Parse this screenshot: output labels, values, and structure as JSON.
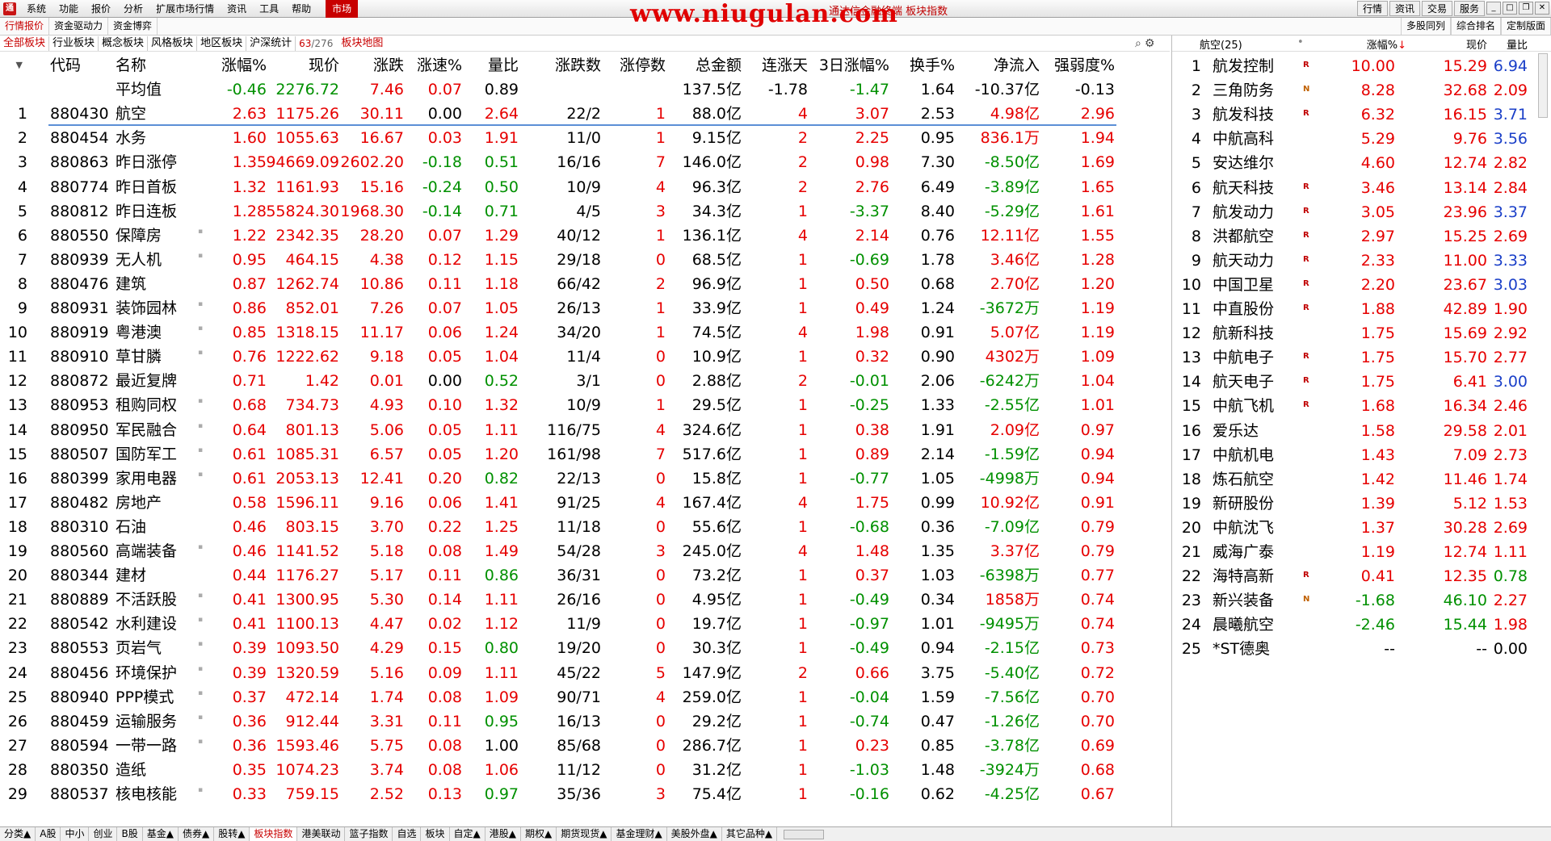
{
  "menubar": {
    "items": [
      "系统",
      "功能",
      "报价",
      "分析",
      "扩展市场行情",
      "资讯",
      "工具",
      "帮助"
    ],
    "active": "市场",
    "watermark": "www.niugulan.com",
    "subtitle": "通达信金融终端 板块指数",
    "right_buttons": [
      "行情",
      "资讯",
      "交易",
      "服务"
    ],
    "window_controls": [
      "_",
      "□",
      "❐",
      "✕"
    ]
  },
  "tabs_left": [
    "行情报价",
    "资金驱动力",
    "资金博弈"
  ],
  "tabs_right": [
    "多股同列",
    "综合排名",
    "定制版面"
  ],
  "categories": [
    "全部板块",
    "行业板块",
    "概念板块",
    "风格板块",
    "地区板块",
    "沪深统计"
  ],
  "counter": {
    "current": "63",
    "total": "276"
  },
  "map_label": "板块地图",
  "main_headers": {
    "code": "代码",
    "name": "名称",
    "chg_pct": "涨幅%",
    "chg_arrow": "↓",
    "price": "现价",
    "chg": "涨跌",
    "speed": "涨速%",
    "vol_ratio": "量比",
    "updown": "涨跌数",
    "limit_up": "涨停数",
    "amount": "总金额",
    "streak": "连涨天",
    "chg3d": "3日涨幅%",
    "turnover": "换手%",
    "netflow": "净流入",
    "strength": "强弱度%"
  },
  "average": {
    "name": "平均值",
    "chg_pct": "-0.46",
    "price": "2276.72",
    "chg": "7.46",
    "speed": "0.07",
    "vol_ratio": "0.89",
    "amount": "137.5亿",
    "streak": "-1.78",
    "chg3d": "-1.47",
    "turnover": "1.64",
    "netflow": "-10.37亿",
    "strength": "-0.13"
  },
  "rows": [
    [
      "1",
      "880430",
      "航空",
      "2.63",
      "1175.26",
      "30.11",
      "0.00",
      "2.64",
      "22/2",
      "1",
      "88.0亿",
      "4",
      "3.07",
      "2.53",
      "4.98亿",
      "2.96"
    ],
    [
      "2",
      "880454",
      "水务",
      "1.60",
      "1055.63",
      "16.67",
      "0.03",
      "1.91",
      "11/0",
      "1",
      "9.15亿",
      "2",
      "2.25",
      "0.95",
      "836.1万",
      "1.94"
    ],
    [
      "3",
      "880863",
      "昨日涨停",
      "1.35",
      "94669.09",
      "2602.20",
      "-0.18",
      "0.51",
      "16/16",
      "7",
      "146.0亿",
      "2",
      "0.98",
      "7.30",
      "-8.50亿",
      "1.69"
    ],
    [
      "4",
      "880774",
      "昨日首板",
      "1.32",
      "1161.93",
      "15.16",
      "-0.24",
      "0.50",
      "10/9",
      "4",
      "96.3亿",
      "2",
      "2.76",
      "6.49",
      "-3.89亿",
      "1.65"
    ],
    [
      "5",
      "880812",
      "昨日连板",
      "1.28",
      "55824.30",
      "1968.30",
      "-0.14",
      "0.71",
      "4/5",
      "3",
      "34.3亿",
      "1",
      "-3.37",
      "8.40",
      "-5.29亿",
      "1.61"
    ],
    [
      "6",
      "880550",
      "保障房",
      "1.22",
      "2342.35",
      "28.20",
      "0.07",
      "1.29",
      "40/12",
      "1",
      "136.1亿",
      "4",
      "2.14",
      "0.76",
      "12.11亿",
      "1.55"
    ],
    [
      "7",
      "880939",
      "无人机",
      "0.95",
      "464.15",
      "4.38",
      "0.12",
      "1.15",
      "29/18",
      "0",
      "68.5亿",
      "1",
      "-0.69",
      "1.78",
      "3.46亿",
      "1.28"
    ],
    [
      "8",
      "880476",
      "建筑",
      "0.87",
      "1262.74",
      "10.86",
      "0.11",
      "1.18",
      "66/42",
      "2",
      "96.9亿",
      "1",
      "0.50",
      "0.68",
      "2.70亿",
      "1.20"
    ],
    [
      "9",
      "880931",
      "装饰园林",
      "0.86",
      "852.01",
      "7.26",
      "0.07",
      "1.05",
      "26/13",
      "1",
      "33.9亿",
      "1",
      "0.49",
      "1.24",
      "-3672万",
      "1.19"
    ],
    [
      "10",
      "880919",
      "粤港澳",
      "0.85",
      "1318.15",
      "11.17",
      "0.06",
      "1.24",
      "34/20",
      "1",
      "74.5亿",
      "4",
      "1.98",
      "0.91",
      "5.07亿",
      "1.19"
    ],
    [
      "11",
      "880910",
      "草甘膦",
      "0.76",
      "1222.62",
      "9.18",
      "0.05",
      "1.04",
      "11/4",
      "0",
      "10.9亿",
      "1",
      "0.32",
      "0.90",
      "4302万",
      "1.09"
    ],
    [
      "12",
      "880872",
      "最近复牌",
      "0.71",
      "1.42",
      "0.01",
      "0.00",
      "0.52",
      "3/1",
      "0",
      "2.88亿",
      "2",
      "-0.01",
      "2.06",
      "-6242万",
      "1.04"
    ],
    [
      "13",
      "880953",
      "租购同权",
      "0.68",
      "734.73",
      "4.93",
      "0.10",
      "1.32",
      "10/9",
      "1",
      "29.5亿",
      "1",
      "-0.25",
      "1.33",
      "-2.55亿",
      "1.01"
    ],
    [
      "14",
      "880950",
      "军民融合",
      "0.64",
      "801.13",
      "5.06",
      "0.05",
      "1.11",
      "116/75",
      "4",
      "324.6亿",
      "1",
      "0.38",
      "1.91",
      "2.09亿",
      "0.97"
    ],
    [
      "15",
      "880507",
      "国防军工",
      "0.61",
      "1085.31",
      "6.57",
      "0.05",
      "1.20",
      "161/98",
      "7",
      "517.6亿",
      "1",
      "0.89",
      "2.14",
      "-1.59亿",
      "0.94"
    ],
    [
      "16",
      "880399",
      "家用电器",
      "0.61",
      "2053.13",
      "12.41",
      "0.20",
      "0.82",
      "22/13",
      "0",
      "15.8亿",
      "1",
      "-0.77",
      "1.05",
      "-4998万",
      "0.94"
    ],
    [
      "17",
      "880482",
      "房地产",
      "0.58",
      "1596.11",
      "9.16",
      "0.06",
      "1.41",
      "91/25",
      "4",
      "167.4亿",
      "4",
      "1.75",
      "0.99",
      "10.92亿",
      "0.91"
    ],
    [
      "18",
      "880310",
      "石油",
      "0.46",
      "803.15",
      "3.70",
      "0.22",
      "1.25",
      "11/18",
      "0",
      "55.6亿",
      "1",
      "-0.68",
      "0.36",
      "-7.09亿",
      "0.79"
    ],
    [
      "19",
      "880560",
      "高端装备",
      "0.46",
      "1141.52",
      "5.18",
      "0.08",
      "1.49",
      "54/28",
      "3",
      "245.0亿",
      "4",
      "1.48",
      "1.35",
      "3.37亿",
      "0.79"
    ],
    [
      "20",
      "880344",
      "建材",
      "0.44",
      "1176.27",
      "5.17",
      "0.11",
      "0.86",
      "36/31",
      "0",
      "73.2亿",
      "1",
      "0.37",
      "1.03",
      "-6398万",
      "0.77"
    ],
    [
      "21",
      "880889",
      "不活跃股",
      "0.41",
      "1300.95",
      "5.30",
      "0.14",
      "1.11",
      "26/16",
      "0",
      "4.95亿",
      "1",
      "-0.49",
      "0.34",
      "1858万",
      "0.74"
    ],
    [
      "22",
      "880542",
      "水利建设",
      "0.41",
      "1100.13",
      "4.47",
      "0.02",
      "1.12",
      "11/9",
      "0",
      "19.7亿",
      "1",
      "-0.97",
      "1.01",
      "-9495万",
      "0.74"
    ],
    [
      "23",
      "880553",
      "页岩气",
      "0.39",
      "1093.50",
      "4.29",
      "0.15",
      "0.80",
      "19/20",
      "0",
      "30.3亿",
      "1",
      "-0.49",
      "0.94",
      "-2.15亿",
      "0.73"
    ],
    [
      "24",
      "880456",
      "环境保护",
      "0.39",
      "1320.59",
      "5.16",
      "0.09",
      "1.11",
      "45/22",
      "5",
      "147.9亿",
      "2",
      "0.66",
      "3.75",
      "-5.40亿",
      "0.72"
    ],
    [
      "25",
      "880940",
      "PPP模式",
      "0.37",
      "472.14",
      "1.74",
      "0.08",
      "1.09",
      "90/71",
      "4",
      "259.0亿",
      "1",
      "-0.04",
      "1.59",
      "-7.56亿",
      "0.70"
    ],
    [
      "26",
      "880459",
      "运输服务",
      "0.36",
      "912.44",
      "3.31",
      "0.11",
      "0.95",
      "16/13",
      "0",
      "29.2亿",
      "1",
      "-0.74",
      "0.47",
      "-1.26亿",
      "0.70"
    ],
    [
      "27",
      "880594",
      "一带一路",
      "0.36",
      "1593.46",
      "5.75",
      "0.08",
      "1.00",
      "85/68",
      "0",
      "286.7亿",
      "1",
      "0.23",
      "0.85",
      "-3.78亿",
      "0.69"
    ],
    [
      "28",
      "880350",
      "造纸",
      "0.35",
      "1074.23",
      "3.74",
      "0.08",
      "1.06",
      "11/12",
      "0",
      "31.2亿",
      "1",
      "-1.03",
      "1.48",
      "-3924万",
      "0.68"
    ],
    [
      "29",
      "880537",
      "核电核能",
      "0.33",
      "759.15",
      "2.52",
      "0.13",
      "0.97",
      "35/36",
      "3",
      "75.4亿",
      "1",
      "-0.16",
      "0.62",
      "-4.25亿",
      "0.67"
    ]
  ],
  "dotted_rows": [
    6,
    7,
    9,
    10,
    11,
    13,
    14,
    15,
    16,
    19,
    21,
    22,
    23,
    24,
    25,
    26,
    27,
    29
  ],
  "right_panel": {
    "title": "航空(25)",
    "col_chg": "涨幅%",
    "col_arrow": "↓",
    "col_price": "现价",
    "col_ratio": "量比",
    "rows": [
      [
        "1",
        "航发控制",
        "R",
        "10.00",
        "15.29",
        "6.94"
      ],
      [
        "2",
        "三角防务",
        "N",
        "8.28",
        "32.68",
        "2.09"
      ],
      [
        "3",
        "航发科技",
        "R",
        "6.32",
        "16.15",
        "3.71"
      ],
      [
        "4",
        "中航高科",
        "",
        "5.29",
        "9.76",
        "3.56"
      ],
      [
        "5",
        "安达维尔",
        "",
        "4.60",
        "12.74",
        "2.82"
      ],
      [
        "6",
        "航天科技",
        "R",
        "3.46",
        "13.14",
        "2.84"
      ],
      [
        "7",
        "航发动力",
        "R",
        "3.05",
        "23.96",
        "3.37"
      ],
      [
        "8",
        "洪都航空",
        "R",
        "2.97",
        "15.25",
        "2.69"
      ],
      [
        "9",
        "航天动力",
        "R",
        "2.33",
        "11.00",
        "3.33"
      ],
      [
        "10",
        "中国卫星",
        "R",
        "2.20",
        "23.67",
        "3.03"
      ],
      [
        "11",
        "中直股份",
        "R",
        "1.88",
        "42.89",
        "1.90"
      ],
      [
        "12",
        "航新科技",
        "",
        "1.75",
        "15.69",
        "2.92"
      ],
      [
        "13",
        "中航电子",
        "R",
        "1.75",
        "15.70",
        "2.77"
      ],
      [
        "14",
        "航天电子",
        "R",
        "1.75",
        "6.41",
        "3.00"
      ],
      [
        "15",
        "中航飞机",
        "R",
        "1.68",
        "16.34",
        "2.46"
      ],
      [
        "16",
        "爱乐达",
        "",
        "1.58",
        "29.58",
        "2.01"
      ],
      [
        "17",
        "中航机电",
        "",
        "1.43",
        "7.09",
        "2.73"
      ],
      [
        "18",
        "炼石航空",
        "",
        "1.42",
        "11.46",
        "1.74"
      ],
      [
        "19",
        "新研股份",
        "",
        "1.39",
        "5.12",
        "1.53"
      ],
      [
        "20",
        "中航沈飞",
        "",
        "1.37",
        "30.28",
        "2.69"
      ],
      [
        "21",
        "威海广泰",
        "",
        "1.19",
        "12.74",
        "1.11"
      ],
      [
        "22",
        "海特高新",
        "R",
        "0.41",
        "12.35",
        "0.78"
      ],
      [
        "23",
        "新兴装备",
        "N",
        "-1.68",
        "46.10",
        "2.27"
      ],
      [
        "24",
        "晨曦航空",
        "",
        "-2.46",
        "15.44",
        "1.98"
      ],
      [
        "25",
        "*ST德奥",
        "",
        "--",
        "--",
        "0.00"
      ]
    ]
  },
  "bottom_tabs": [
    "分类▲",
    "A股",
    "中小",
    "创业",
    "B股",
    "基金▲",
    "债券▲",
    "股转▲",
    "板块指数",
    "港美联动",
    "篮子指数",
    "自选",
    "板块",
    "自定▲",
    "港股▲",
    "期权▲",
    "期货现货▲",
    "基金理财▲",
    "美股外盘▲",
    "其它品种▲"
  ],
  "active_bottom_tab": "板块指数",
  "colors": {
    "up": "#e60000",
    "down": "#009000",
    "accent": "#c80000",
    "ratio_high": "#1a3fc8"
  }
}
